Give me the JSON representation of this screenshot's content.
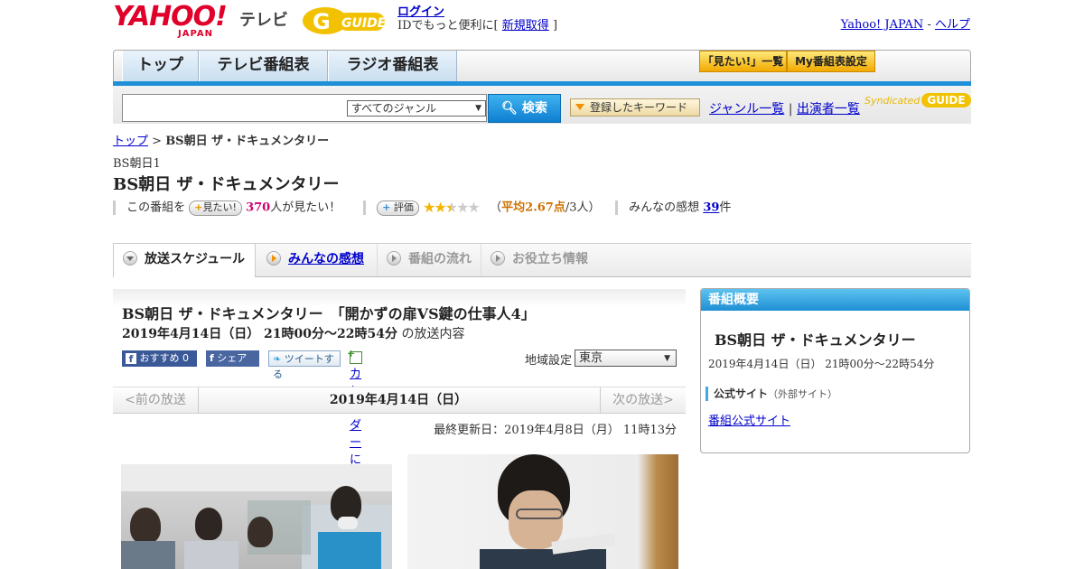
{
  "header": {
    "logo_yahoo": "YAHOO!",
    "logo_japan": "JAPAN",
    "logo_tv": "テレビ",
    "logo_gguide": "GUIDE",
    "login_link": "ログイン",
    "login_text": "IDでもっと便利に[",
    "signup_link": "新規取得",
    "login_close": "]",
    "yahoo_japan_link": "Yahoo! JAPAN",
    "help_sep": " - ",
    "help_link": "ヘルプ"
  },
  "nav": {
    "tabs": [
      "トップ",
      "テレビ番組表",
      "ラジオ番組表"
    ],
    "mitai_list": "「見たい!」一覧",
    "my_schedule": "My番組表設定"
  },
  "search": {
    "genre_selected": "すべてのジャンル",
    "search_button": "検索",
    "keyword_button": "登録したキーワード",
    "genre_list_link": "ジャンル一覧",
    "cast_list_link": "出演者一覧",
    "divider": "|",
    "syndicated": "Syndicated",
    "syndicated_logo": "GUIDE"
  },
  "breadcrumb": {
    "top": "トップ",
    "sep": " > ",
    "current": "BS朝日 ザ・ドキュメンタリー"
  },
  "program": {
    "channel": "BS朝日1",
    "title": "BS朝日 ザ・ドキュメンタリー",
    "mitai_prefix": "この番組を",
    "mitai_button": "見たい!",
    "mitai_count": "370",
    "mitai_suffix": "人が見たい！",
    "rating_button": "評価",
    "rating_open": "（",
    "rating_avg": "平均2.67点",
    "rating_people": "/3人）",
    "rating_value": 2.67,
    "impressions_label": "みんなの感想",
    "impressions_count": "39",
    "impressions_suffix": "件"
  },
  "content_tabs": [
    "放送スケジュール",
    "みんなの感想",
    "番組の流れ",
    "お役立ち情報"
  ],
  "episode": {
    "title": "BS朝日 ザ・ドキュメンタリー　「開かずの扉VS鍵の仕事人4」",
    "datetime": "2019年4月14日（日）  21時00分～22時54分",
    "datetime_suffix": "の放送内容",
    "share_recommend": "おすすめ 0",
    "share_fb": "シェア",
    "share_tweet": "ツイートする",
    "calendar": "カレンダーに登録",
    "area_label": "地域設定",
    "area_value": "東京"
  },
  "pager": {
    "prev": "<前の放送",
    "date": "2019年4月14日（日）",
    "next": "次の放送>"
  },
  "updated": "最終更新日：2019年4月8日（月）  11時13分",
  "panel": {
    "head": "番組概要",
    "title": "BS朝日 ザ・ドキュメンタリー",
    "datetime": "2019年4月14日（日）  21時00分～22時54分",
    "site_label": "公式サイト",
    "site_note": "（外部サイト）",
    "site_link": "番組公式サイト"
  },
  "colors": {
    "brand_red": "#e0002a",
    "accent_blue": "#1e90d8",
    "link": "#0000cc",
    "highlight_pink": "#d0006f",
    "star": "#f2b600"
  }
}
